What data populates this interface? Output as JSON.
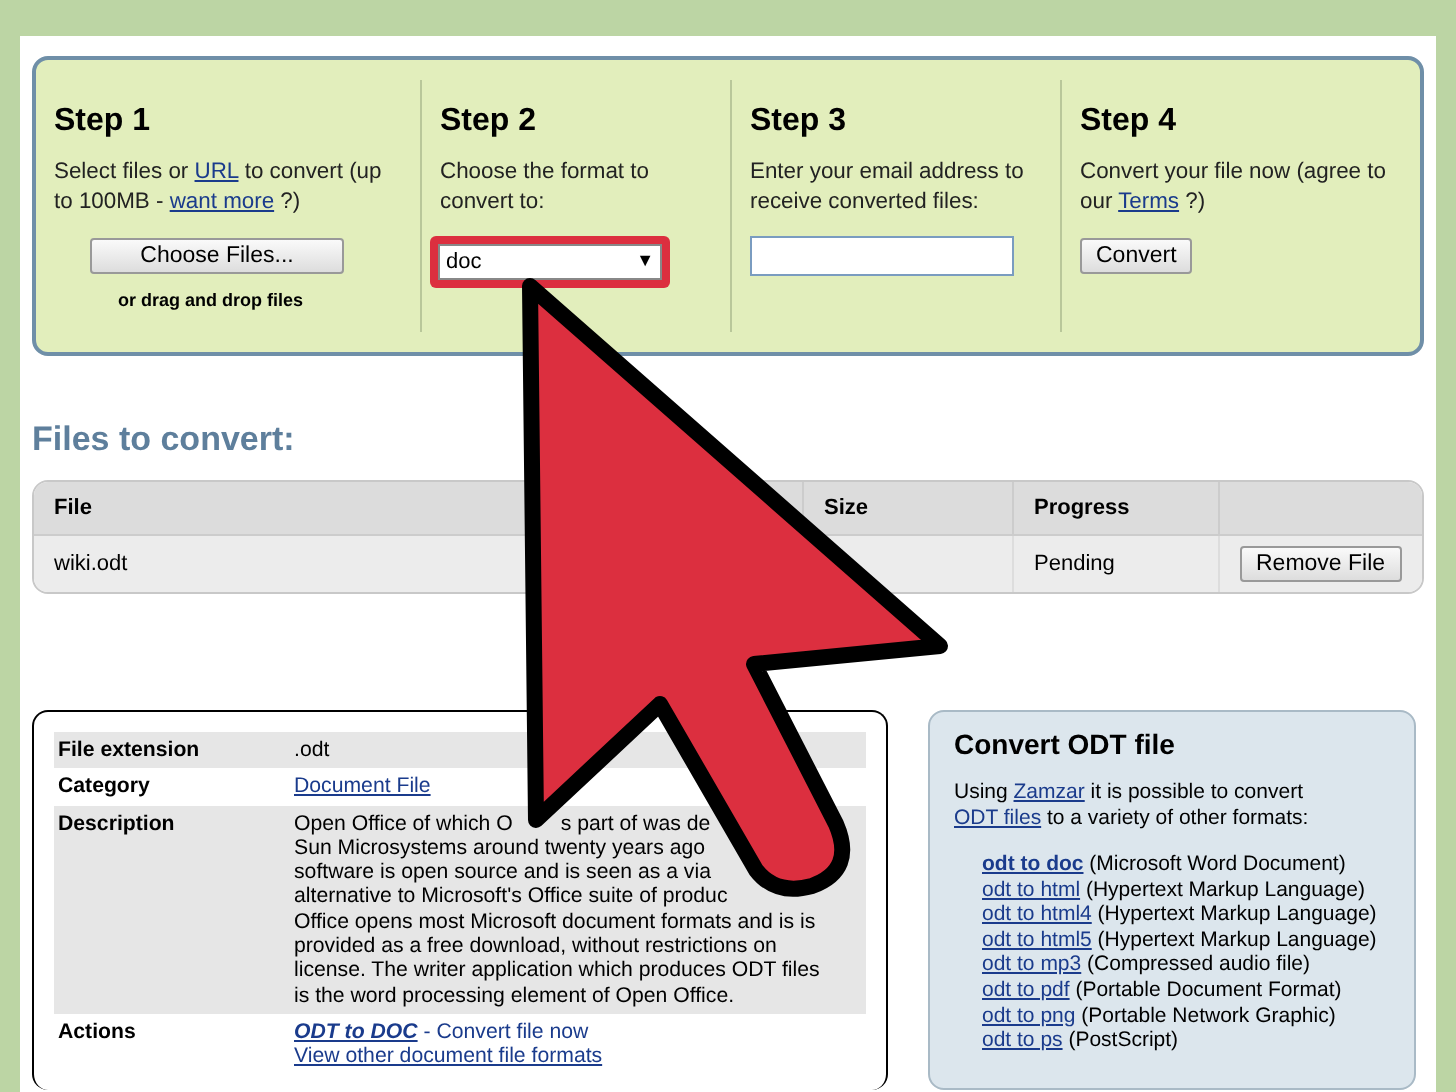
{
  "steps": [
    {
      "title": "Step 1",
      "text": [
        {
          "t": "Select files or ",
          "kind": "text"
        },
        {
          "t": "URL",
          "kind": "link"
        },
        {
          "t": " to convert (up to 100MB - ",
          "kind": "text"
        },
        {
          "t": "want more",
          "kind": "link"
        },
        {
          "t": " ?)",
          "kind": "text"
        }
      ],
      "control": {
        "kind": "button",
        "label": "Choose Files..."
      },
      "note": "or drag and drop files"
    },
    {
      "title": "Step 2",
      "text": [
        {
          "t": "Choose the format to convert to:",
          "kind": "text"
        }
      ],
      "control": {
        "kind": "select",
        "value": "doc",
        "caret": "▼",
        "highlighted": true
      }
    },
    {
      "title": "Step 3",
      "text": [
        {
          "t": "Enter your email address to receive converted files:",
          "kind": "text"
        }
      ],
      "control": {
        "kind": "input"
      }
    },
    {
      "title": "Step 4",
      "text": [
        {
          "t": "Convert your file now (agree to our ",
          "kind": "text"
        },
        {
          "t": "Terms",
          "kind": "link"
        },
        {
          "t": " ?)",
          "kind": "text"
        }
      ],
      "control": {
        "kind": "button",
        "label": "Convert"
      }
    }
  ],
  "files_heading": "Files to convert:",
  "files_table": {
    "columns": [
      "File",
      "Size",
      "Progress"
    ],
    "rows": [
      {
        "file": "wiki.odt",
        "progress": "Pending",
        "action": "Remove File"
      }
    ]
  },
  "info": [
    {
      "label": "File extension",
      "kind": "text",
      "lines": [
        [
          ".odt"
        ]
      ]
    },
    {
      "label": "Category",
      "kind": "link",
      "lines": [
        "Document File"
      ]
    },
    {
      "label": "Description",
      "kind": "text",
      "lines": [
        [
          "Open Office of which O",
          "s part of was de"
        ],
        [
          "Sun Microsystems around twenty years ago"
        ],
        [
          "software is open source and is seen as a via"
        ],
        [
          "alternative to Microsoft's Office suite of produc"
        ],
        [
          "Office opens most Microsoft document formats and is is"
        ],
        [
          "provided as a free download, without restrictions on"
        ],
        [
          "license. The writer application which produces ODT files"
        ],
        [
          "is the word processing element of Open Office."
        ]
      ]
    },
    {
      "label": "Actions",
      "kind": "actions",
      "lines": [
        "ODT to DOC",
        "- Convert file now",
        "View other document file formats"
      ]
    }
  ],
  "convert_box": {
    "title": "Convert ODT file",
    "intro": [
      {
        "t": "Using ",
        "kind": "text"
      },
      {
        "t": "Zamzar",
        "kind": "link"
      },
      {
        "t": " it is possible to convert ",
        "kind": "text"
      },
      {
        "t": "ODT files",
        "kind": "link"
      },
      {
        "t": " to a variety of other formats:",
        "kind": "text"
      }
    ],
    "formats": [
      {
        "link": "odt to doc",
        "desc": "(Microsoft Word Document)",
        "bold": true
      },
      {
        "link": "odt to html",
        "desc": "(Hypertext Markup Language)",
        "bold": false
      },
      {
        "link": "odt to html4",
        "desc": "(Hypertext Markup Language)",
        "bold": false
      },
      {
        "link": "odt to html5",
        "desc": "(Hypertext Markup Language)",
        "bold": false
      },
      {
        "link": "odt to mp3",
        "desc": "(Compressed audio file)",
        "bold": false
      },
      {
        "link": "odt to pdf",
        "desc": "(Portable Document Format)",
        "bold": false
      },
      {
        "link": "odt to png",
        "desc": "(Portable Network Graphic)",
        "bold": false
      },
      {
        "link": "odt to ps",
        "desc": "(PostScript)",
        "bold": false
      }
    ]
  }
}
